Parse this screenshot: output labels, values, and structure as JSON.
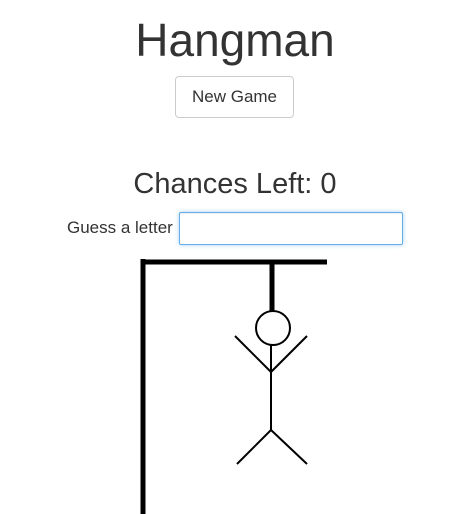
{
  "game": {
    "title": "Hangman",
    "new_game_label": "New Game",
    "chances_text": "Chances Left: 0",
    "chances_left": 0,
    "guess_label": "Guess a letter",
    "guess_value": "",
    "guess_placeholder": ""
  },
  "drawing": {
    "stroke_color": "#000000",
    "parts_shown": [
      "base-post",
      "top-beam",
      "rope",
      "head",
      "body",
      "left-arm",
      "right-arm",
      "left-leg",
      "right-leg"
    ]
  }
}
